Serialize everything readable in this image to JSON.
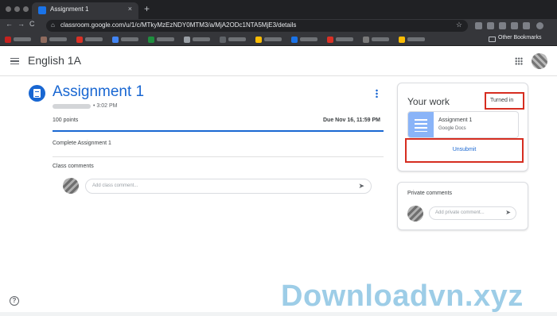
{
  "browser": {
    "tab_title": "Assignment 1",
    "tab_close": "×",
    "new_tab": "+",
    "back": "←",
    "forward": "→",
    "reload": "C",
    "home": "⌂",
    "lock": "🔒",
    "url": "classroom.google.com/u/1/c/MTkyMzEzNDY0MTM3/a/MjA2ODc1NTA5MjE3/details",
    "star": "☆",
    "other_bookmarks": "Other Bookmarks",
    "bookmark_colors": [
      "#c5221f",
      "#8f6b5e",
      "#d93025",
      "#4285f4",
      "#1e8e3e",
      "#9aa0a6",
      "#5f6368",
      "#fbbc04",
      "#1a73e8",
      "#d93025",
      "#7a7a7a",
      "#fbbc04"
    ]
  },
  "header": {
    "class_name": "English 1A",
    "apps_icon": "apps-grid-icon"
  },
  "assignment": {
    "title": "Assignment 1",
    "time": "• 3:02 PM",
    "points": "100 points",
    "due": "Due Nov 16, 11:59 PM",
    "instructions": "Complete Assignment 1",
    "class_comments_label": "Class comments",
    "comment_placeholder": "Add class comment..."
  },
  "your_work": {
    "title": "Your work",
    "status": "Turned in",
    "attachment_title": "Assignment 1",
    "attachment_type": "Google Docs",
    "unsubmit_label": "Unsubmit",
    "highlight_color": "#d62d20"
  },
  "private_comments": {
    "title": "Private comments",
    "placeholder": "Add private comment..."
  },
  "help": "?",
  "watermark": "Downloadvn.xyz",
  "colors": {
    "accent": "#1967d2"
  }
}
